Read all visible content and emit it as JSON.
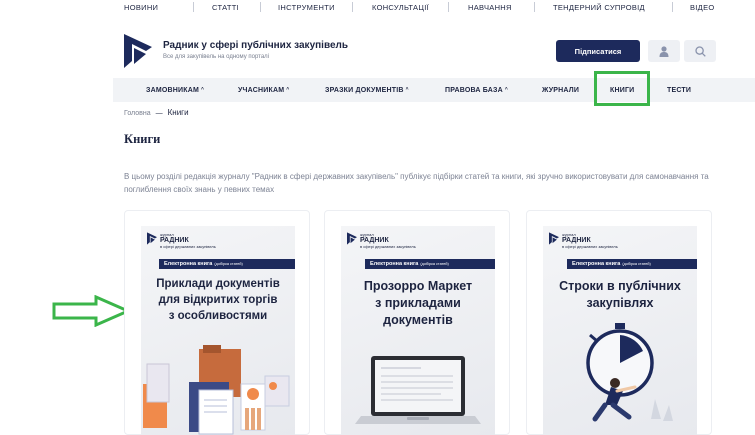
{
  "topnav": [
    "НОВИНИ",
    "СТАТТІ",
    "ІНСТРУМЕНТИ",
    "КОНСУЛЬТАЦІЇ",
    "НАВЧАННЯ",
    "ТЕНДЕРНИЙ СУПРОВІД",
    "ВІДЕО"
  ],
  "brand": {
    "title": "Радник у сфері публічних закупівель",
    "subtitle": "Все для закупівель на одному порталі"
  },
  "header": {
    "subscribe_label": "Підписатися",
    "user_icon": "user-icon",
    "search_icon": "search-icon"
  },
  "mainnav": [
    {
      "label": "ЗАМОВНИКАМ",
      "caret": "^"
    },
    {
      "label": "УЧАСНИКАМ",
      "caret": "^"
    },
    {
      "label": "ЗРАЗКИ ДОКУМЕНТІВ",
      "caret": "^"
    },
    {
      "label": "ПРАВОВА БАЗА",
      "caret": "^"
    },
    {
      "label": "ЖУРНАЛИ",
      "caret": ""
    },
    {
      "label": "КНИГИ",
      "caret": ""
    },
    {
      "label": "ТЕСТИ",
      "caret": ""
    }
  ],
  "breadcrumb": {
    "home": "Головна",
    "separator": "—",
    "current": "Книги"
  },
  "page_title": "Книги",
  "intro": "В цьому розділі редакція журналу \"Радник в сфері державних закупівель\" публікує підбірки статей та книги, які зручно використовувати для самонавчання та поглиблення своїх знань у певних темах",
  "cover_brand": {
    "small_top": "журнал",
    "name": "РАДНИК",
    "small_bottom": "в сфері державних закупівель"
  },
  "book_badge": {
    "text": "Електронна книга",
    "note": "(добірка статей)"
  },
  "books": [
    {
      "title_lines": [
        "Приклади документів",
        "для відкритих торгів",
        "з особливостями"
      ]
    },
    {
      "title_lines": [
        "Прозорро Маркет",
        "з прикладами",
        "документів"
      ]
    },
    {
      "title_lines": [
        "Строки в публічних",
        "закупівлях"
      ]
    }
  ],
  "colors": {
    "accent": "#1d2a5c",
    "highlight": "#3bb54a",
    "nav_bg": "#f1f3f6"
  }
}
